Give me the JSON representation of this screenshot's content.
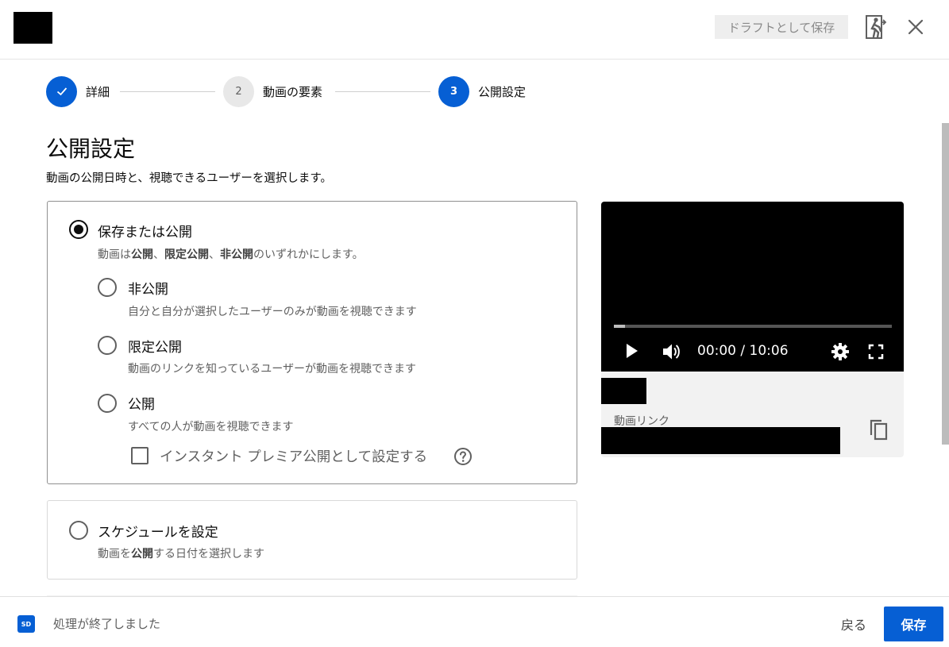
{
  "header": {
    "draft_button": "ドラフトとして保存"
  },
  "stepper": {
    "steps": [
      {
        "number": "",
        "label": "詳細",
        "state": "done"
      },
      {
        "number": "2",
        "label": "動画の要素",
        "state": "pending"
      },
      {
        "number": "3",
        "label": "公開設定",
        "state": "active"
      }
    ]
  },
  "page": {
    "title": "公開設定",
    "subtitle": "動画の公開日時と、視聴できるユーザーを選択します。"
  },
  "save_publish": {
    "title": "保存または公開",
    "desc_parts": [
      "動画は",
      "公開",
      "、",
      "限定公開",
      "、",
      "非公開",
      "のいずれかにします。"
    ],
    "selected": true,
    "options": [
      {
        "title": "非公開",
        "desc": "自分と自分が選択したユーザーのみが動画を視聴できます",
        "selected": false
      },
      {
        "title": "限定公開",
        "desc": "動画のリンクを知っているユーザーが動画を視聴できます",
        "selected": false
      },
      {
        "title": "公開",
        "desc": "すべての人が動画を視聴できます",
        "selected": false
      }
    ],
    "premiere_checkbox": {
      "label": "インスタント プレミア公開として設定する",
      "checked": false
    }
  },
  "schedule": {
    "title": "スケジュールを設定",
    "desc_parts": [
      "動画を",
      "公開",
      "する日付を選択します"
    ],
    "selected": false
  },
  "preview": {
    "time": "00:00 / 10:06",
    "progress_fraction": 0.04,
    "link_label": "動画リンク"
  },
  "footer": {
    "badge": "SD",
    "status": "処理が終了しました",
    "back_button": "戻る",
    "save_button": "保存"
  },
  "colors": {
    "accent": "#065fd4",
    "text_secondary": "#606060"
  },
  "icons": [
    "check-icon",
    "exit-icon",
    "close-icon",
    "help-icon",
    "play-icon",
    "volume-icon",
    "gear-icon",
    "fullscreen-icon",
    "copy-icon"
  ]
}
